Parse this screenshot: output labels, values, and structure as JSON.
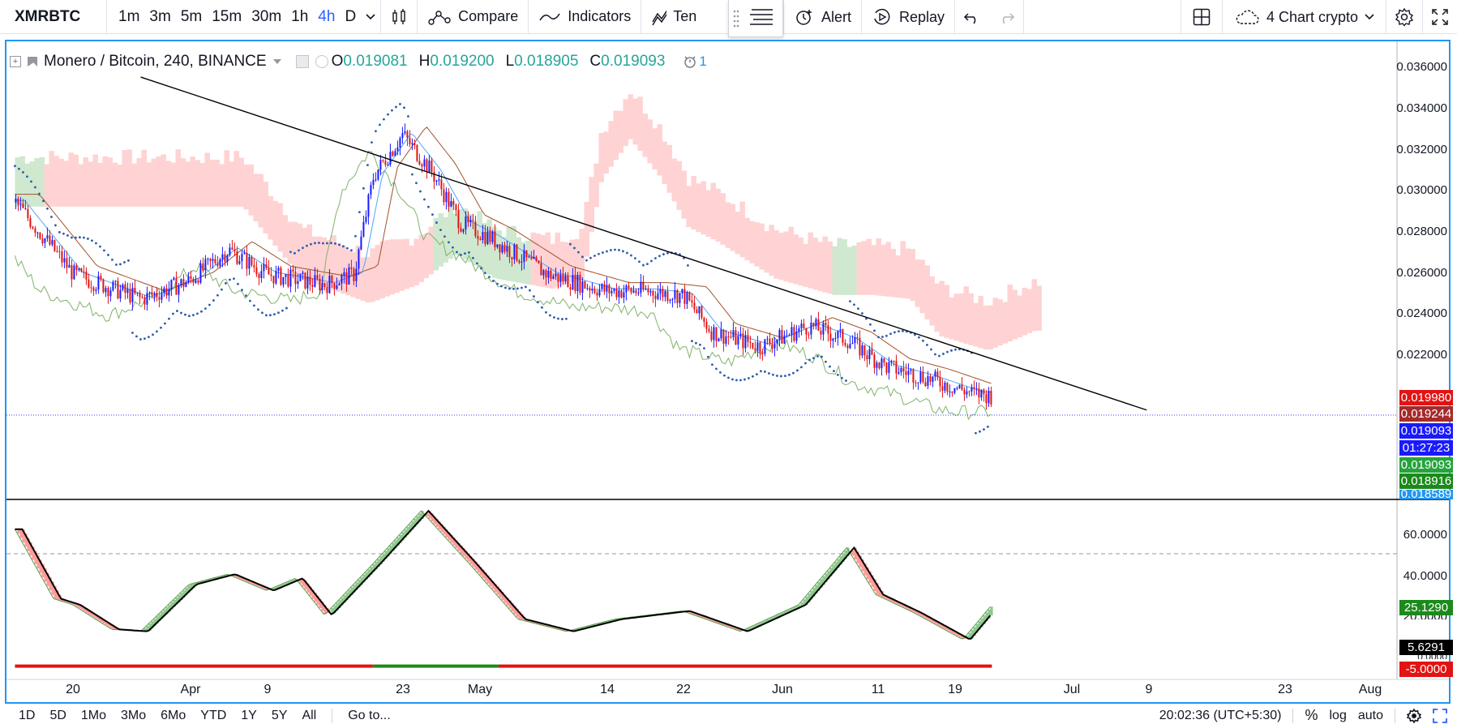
{
  "toolbar": {
    "symbol": "XMRBTC",
    "intervals": [
      "1m",
      "3m",
      "5m",
      "15m",
      "30m",
      "1h",
      "4h",
      "D"
    ],
    "active_interval": "4h",
    "compare_label": "Compare",
    "indicators_label": "Indicators",
    "templates_label": "Ten",
    "alert_label": "Alert",
    "replay_label": "Replay",
    "layout_label": "4 Chart crypto"
  },
  "legend": {
    "title": "Monero / Bitcoin, 240, BINANCE",
    "open_key": "O",
    "open": "0.019081",
    "high_key": "H",
    "high": "0.019200",
    "low_key": "L",
    "low": "0.018905",
    "close_key": "C",
    "close": "0.019093",
    "alerts_count": "1"
  },
  "price_scale": {
    "labels": [
      "0.036000",
      "0.034000",
      "0.032000",
      "0.030000",
      "0.028000",
      "0.026000",
      "0.024000",
      "0.022000"
    ],
    "tags": [
      {
        "text": "0.019980",
        "color": "#e21313"
      },
      {
        "text": "0.019244",
        "color": "#a52a2a"
      },
      {
        "text": "0.019093",
        "color": "#1a1aff"
      },
      {
        "text": "01:27:23",
        "color": "#1a1aff"
      },
      {
        "text": "0.019093",
        "color": "#26a33e"
      },
      {
        "text": "0.018916",
        "color": "#1b8a1b"
      },
      {
        "text": "0.018589",
        "color": "#2196f3"
      }
    ]
  },
  "osc_scale": {
    "labels": [
      "60.0000",
      "40.0000",
      "20.0000",
      "0.0000"
    ],
    "tags": [
      {
        "text": "25.1290",
        "color": "#1b8a1b"
      },
      {
        "text": "5.6291",
        "color": "#000000"
      },
      {
        "text": "-5.0000",
        "color": "#e21313"
      }
    ]
  },
  "time_axis": [
    "20",
    "Apr",
    "9",
    "23",
    "May",
    "14",
    "22",
    "Jun",
    "11",
    "19",
    "Jul",
    "9",
    "23",
    "Aug"
  ],
  "bottom_bar": {
    "ranges": [
      "1D",
      "5D",
      "1Mo",
      "3Mo",
      "6Mo",
      "YTD",
      "1Y",
      "5Y",
      "All"
    ],
    "goto_label": "Go to...",
    "clock": "20:02:36 (UTC+5:30)",
    "percent_label": "%",
    "log_label": "log",
    "auto_label": "auto"
  },
  "colors": {
    "accent": "#2962ff",
    "up": "#1a1aff",
    "down": "#e21313",
    "cloud_bear": "#ffd3d3",
    "cloud_bull": "#cfe8cf",
    "osc_green": "#8fc88f",
    "osc_red": "#ff9b9b"
  },
  "chart_data": {
    "type": "line",
    "symbol": "Monero / Bitcoin, 240, BINANCE",
    "ylim": [
      0.0185,
      0.0368
    ],
    "x_ticks": [
      "20",
      "Apr",
      "9",
      "23",
      "May",
      "14",
      "22",
      "Jun",
      "11",
      "19",
      "Jul",
      "9",
      "23",
      "Aug"
    ],
    "close_approx": [
      {
        "x": "Mar 14",
        "y": 0.0285
      },
      {
        "x": "Mar 20",
        "y": 0.025
      },
      {
        "x": "Mar 27",
        "y": 0.0238
      },
      {
        "x": "Apr 1",
        "y": 0.0247
      },
      {
        "x": "Apr 5",
        "y": 0.0262
      },
      {
        "x": "Apr 9",
        "y": 0.025
      },
      {
        "x": "Apr 15",
        "y": 0.0245
      },
      {
        "x": "Apr 18",
        "y": 0.025
      },
      {
        "x": "Apr 20",
        "y": 0.0298
      },
      {
        "x": "Apr 23",
        "y": 0.0318
      },
      {
        "x": "Apr 26",
        "y": 0.03
      },
      {
        "x": "Apr 29",
        "y": 0.0275
      },
      {
        "x": "May 2",
        "y": 0.0268
      },
      {
        "x": "May 8",
        "y": 0.025
      },
      {
        "x": "May 14",
        "y": 0.0242
      },
      {
        "x": "May 18",
        "y": 0.0242
      },
      {
        "x": "May 22",
        "y": 0.024
      },
      {
        "x": "May 25",
        "y": 0.0222
      },
      {
        "x": "May 30",
        "y": 0.0215
      },
      {
        "x": "Jun 4",
        "y": 0.0225
      },
      {
        "x": "Jun 8",
        "y": 0.0218
      },
      {
        "x": "Jun 12",
        "y": 0.0205
      },
      {
        "x": "Jun 16",
        "y": 0.02
      },
      {
        "x": "Jun 21",
        "y": 0.0192
      },
      {
        "x": "Jun 23",
        "y": 0.0191
      }
    ],
    "last": {
      "open": 0.019081,
      "high": 0.0192,
      "low": 0.018905,
      "close": 0.019093
    },
    "trendline": [
      {
        "x": "Mar 27",
        "y": 0.0346
      },
      {
        "x": "Jul 9",
        "y": 0.0184
      }
    ],
    "oscillator": {
      "ylim": [
        -8,
        76
      ],
      "level": 50,
      "last": 25.129,
      "signal_last": 5.6291,
      "floor": -5.0,
      "values_approx": [
        {
          "x": "Mar 14",
          "y": 62
        },
        {
          "x": "Mar 18",
          "y": 28
        },
        {
          "x": "Mar 20",
          "y": 25
        },
        {
          "x": "Mar 24",
          "y": 13
        },
        {
          "x": "Mar 27",
          "y": 12
        },
        {
          "x": "Apr 1",
          "y": 35
        },
        {
          "x": "Apr 5",
          "y": 40
        },
        {
          "x": "Apr 9",
          "y": 32
        },
        {
          "x": "Apr 12",
          "y": 38
        },
        {
          "x": "Apr 15",
          "y": 20
        },
        {
          "x": "Apr 20",
          "y": 45
        },
        {
          "x": "Apr 25",
          "y": 71
        },
        {
          "x": "Apr 30",
          "y": 45
        },
        {
          "x": "May 5",
          "y": 18
        },
        {
          "x": "May 10",
          "y": 12
        },
        {
          "x": "May 15",
          "y": 18
        },
        {
          "x": "May 22",
          "y": 22
        },
        {
          "x": "May 28",
          "y": 12
        },
        {
          "x": "Jun 3",
          "y": 25
        },
        {
          "x": "Jun 8",
          "y": 53
        },
        {
          "x": "Jun 11",
          "y": 30
        },
        {
          "x": "Jun 15",
          "y": 21
        },
        {
          "x": "Jun 20",
          "y": 8
        },
        {
          "x": "Jun 23",
          "y": 25
        }
      ]
    }
  }
}
